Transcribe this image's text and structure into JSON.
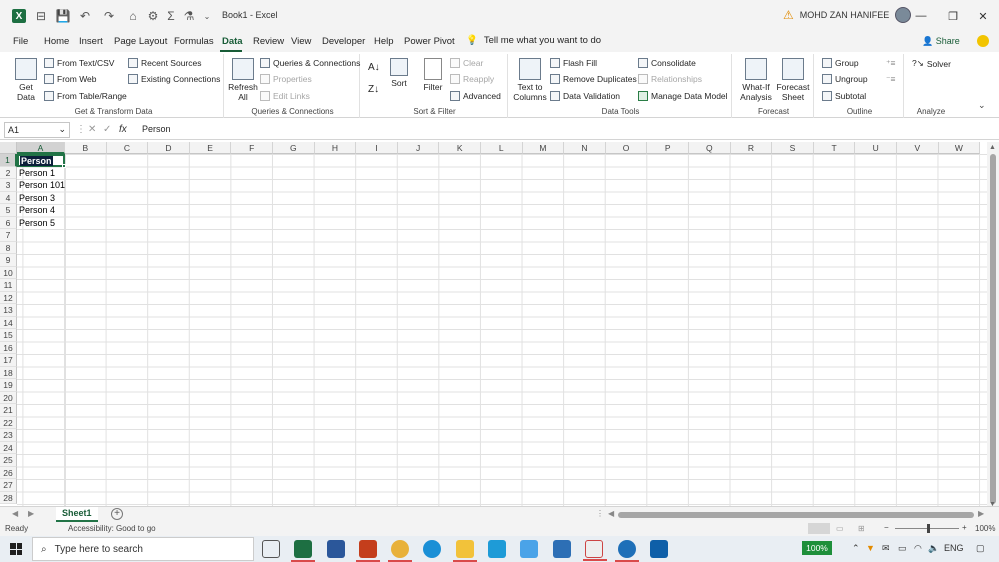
{
  "titlebar": {
    "doc_title": "Book1  -  Excel",
    "user_name": "MOHD ZAN HANIFEE",
    "icons": [
      "excel-logo",
      "autosave-icon",
      "save-icon",
      "undo-icon",
      "redo-icon",
      "quick-access-icon",
      "customize-icon",
      "sum-icon",
      "drawing-icon",
      "more-icon"
    ]
  },
  "menu": {
    "items": [
      "File",
      "Home",
      "Insert",
      "Page Layout",
      "Formulas",
      "Data",
      "Review",
      "View",
      "Developer",
      "Help",
      "Power Pivot"
    ],
    "active": "Data",
    "tell_me": "Tell me what you want to do",
    "share": "Share"
  },
  "ribbon": {
    "get_transform": {
      "label": "Get & Transform Data",
      "get_data": "Get\nData",
      "from_text": "From Text/CSV",
      "from_web": "From Web",
      "from_table": "From Table/Range",
      "recent_sources": "Recent Sources",
      "existing_connections": "Existing Connections"
    },
    "queries": {
      "label": "Queries & Connections",
      "refresh_all": "Refresh\nAll",
      "queries_connections": "Queries & Connections",
      "properties": "Properties",
      "edit_links": "Edit Links"
    },
    "sort_filter": {
      "label": "Sort & Filter",
      "sort": "Sort",
      "filter": "Filter",
      "clear": "Clear",
      "reapply": "Reapply",
      "advanced": "Advanced"
    },
    "data_tools": {
      "label": "Data Tools",
      "text_to_columns": "Text to\nColumns",
      "flash_fill": "Flash Fill",
      "remove_duplicates": "Remove Duplicates",
      "data_validation": "Data Validation",
      "consolidate": "Consolidate",
      "relationships": "Relationships",
      "manage_data_model": "Manage Data Model"
    },
    "forecast": {
      "label": "Forecast",
      "what_if": "What-If\nAnalysis",
      "forecast_sheet": "Forecast\nSheet"
    },
    "outline": {
      "label": "Outline",
      "group": "Group",
      "ungroup": "Ungroup",
      "subtotal": "Subtotal"
    },
    "analyze": {
      "label": "Analyze",
      "solver": "Solver"
    }
  },
  "formula_bar": {
    "name_box": "A1",
    "formula": "Person"
  },
  "grid": {
    "columns": [
      "A",
      "B",
      "C",
      "D",
      "E",
      "F",
      "G",
      "H",
      "I",
      "J",
      "K",
      "L",
      "M",
      "N",
      "O",
      "P",
      "Q",
      "R",
      "S",
      "T",
      "U",
      "V",
      "W"
    ],
    "rows": [
      "1",
      "2",
      "3",
      "4",
      "5",
      "6",
      "7",
      "8",
      "9",
      "10",
      "11",
      "12",
      "13",
      "14",
      "15",
      "16",
      "17",
      "18",
      "19",
      "20",
      "21",
      "22",
      "23",
      "24",
      "25",
      "26",
      "27",
      "28"
    ],
    "cells_a": [
      "Person",
      "Person 1",
      "Person 101",
      "Person 3",
      "Person 4",
      "Person 5"
    ]
  },
  "sheets": {
    "tabs": [
      "Sheet1"
    ],
    "active": "Sheet1"
  },
  "status": {
    "ready": "Ready",
    "accessibility": "Accessibility: Good to go",
    "zoom": "100%"
  },
  "taskbar": {
    "search_placeholder": "Type here to search",
    "battery": "100%",
    "language": "ENG",
    "apps": [
      "task-view",
      "excel",
      "word",
      "powerpoint",
      "chrome",
      "edge",
      "file-explorer",
      "lyx",
      "phone",
      "mail",
      "snipping-tool",
      "camera",
      "outlook"
    ]
  }
}
